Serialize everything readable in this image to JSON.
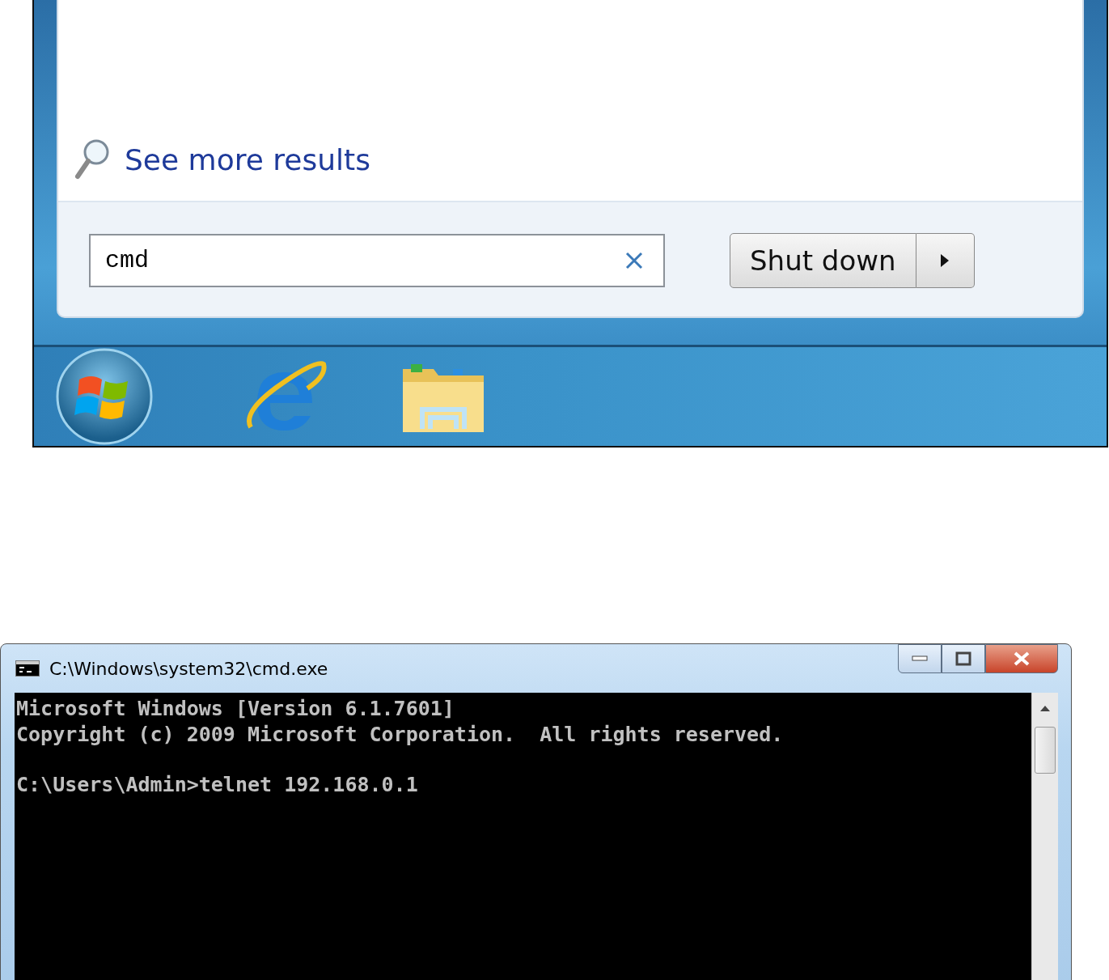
{
  "start_menu": {
    "see_more_link": "See more results",
    "search": {
      "value": "cmd"
    },
    "shutdown_button": "Shut down"
  },
  "cmd_window": {
    "title": "C:\\Windows\\system32\\cmd.exe",
    "console": {
      "header_lines": [
        "Microsoft Windows [Version 6.1.7601]",
        "Copyright (c) 2009 Microsoft Corporation.  All rights reserved."
      ],
      "prompt_line": "C:\\Users\\Admin>telnet 192.168.0.1"
    }
  }
}
